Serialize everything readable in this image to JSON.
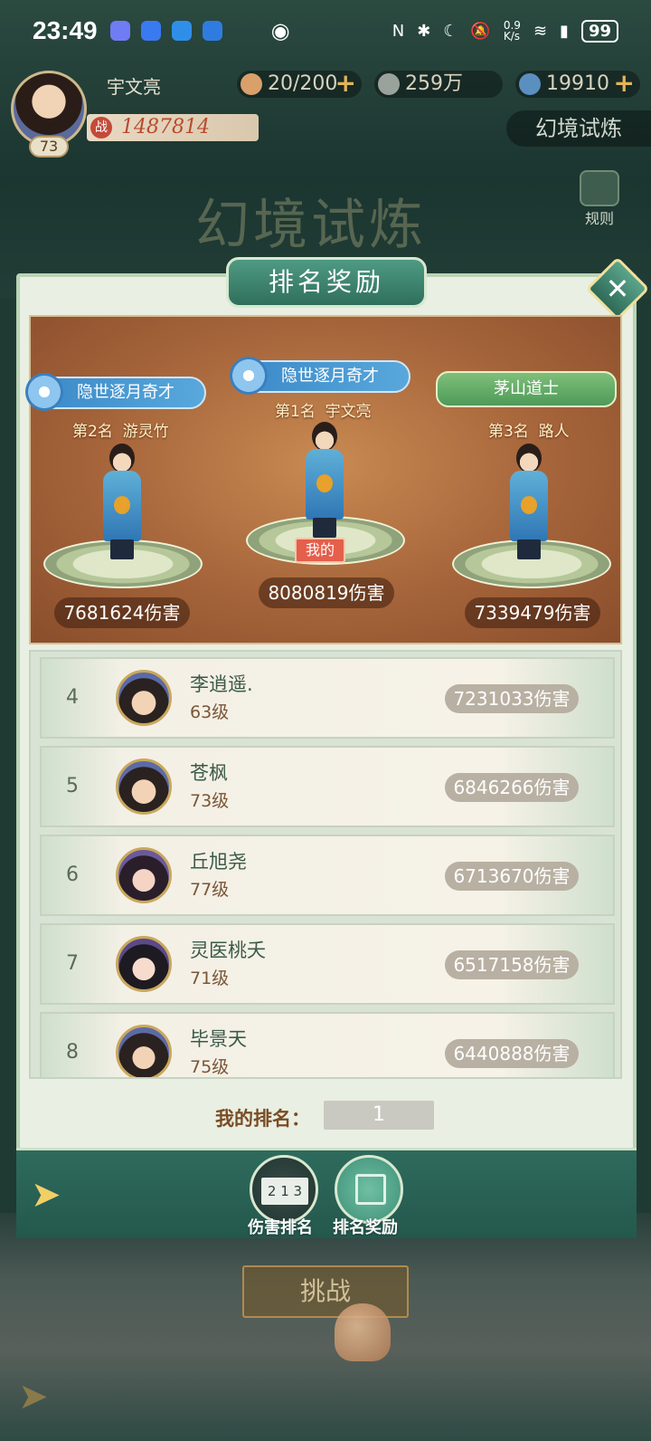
{
  "status_bar": {
    "time": "23:49",
    "net_speed": "0.9\nK/s",
    "battery": "99"
  },
  "player": {
    "name": "宇文亮",
    "level": "73",
    "power": "1487814",
    "power_badge": "战"
  },
  "resources": [
    {
      "value": "20/200",
      "color": "#d9a06a"
    },
    {
      "value": "259万",
      "color": "#9aa39b"
    },
    {
      "value": "19910",
      "color": "#5b8fbf"
    }
  ],
  "mode_tag": "幻境试炼",
  "background_title": "幻境试炼",
  "rule_label": "规则",
  "panel": {
    "title": "排名奖励",
    "close": "✕",
    "podium": {
      "first": {
        "banner": "隐世逐月奇才",
        "rank": "第1名",
        "name": "宇文亮",
        "badge": "我的",
        "damage": "8080819伤害"
      },
      "second": {
        "banner": "隐世逐月奇才",
        "rank": "第2名",
        "name": "游灵竹",
        "damage": "7681624伤害"
      },
      "third": {
        "banner": "茅山道士",
        "rank": "第3名",
        "name": "路人",
        "damage": "7339479伤害"
      }
    },
    "list": [
      {
        "rank": "4",
        "name": "李逍遥.",
        "level": "63级",
        "damage": "7231033伤害"
      },
      {
        "rank": "5",
        "name": "苍枫",
        "level": "73级",
        "damage": "6846266伤害"
      },
      {
        "rank": "6",
        "name": "丘旭尧",
        "level": "77级",
        "damage": "6713670伤害"
      },
      {
        "rank": "7",
        "name": "灵医桃夭",
        "level": "71级",
        "damage": "6517158伤害"
      },
      {
        "rank": "8",
        "name": "毕景天",
        "level": "75级",
        "damage": "6440888伤害"
      }
    ],
    "my_rank_label": "我的排名：",
    "my_rank_value": "1"
  },
  "tabs": [
    {
      "label": "伤害排名",
      "icon_text": "2 1 3"
    },
    {
      "label": "排名奖励"
    }
  ],
  "challenge_label": "挑战"
}
